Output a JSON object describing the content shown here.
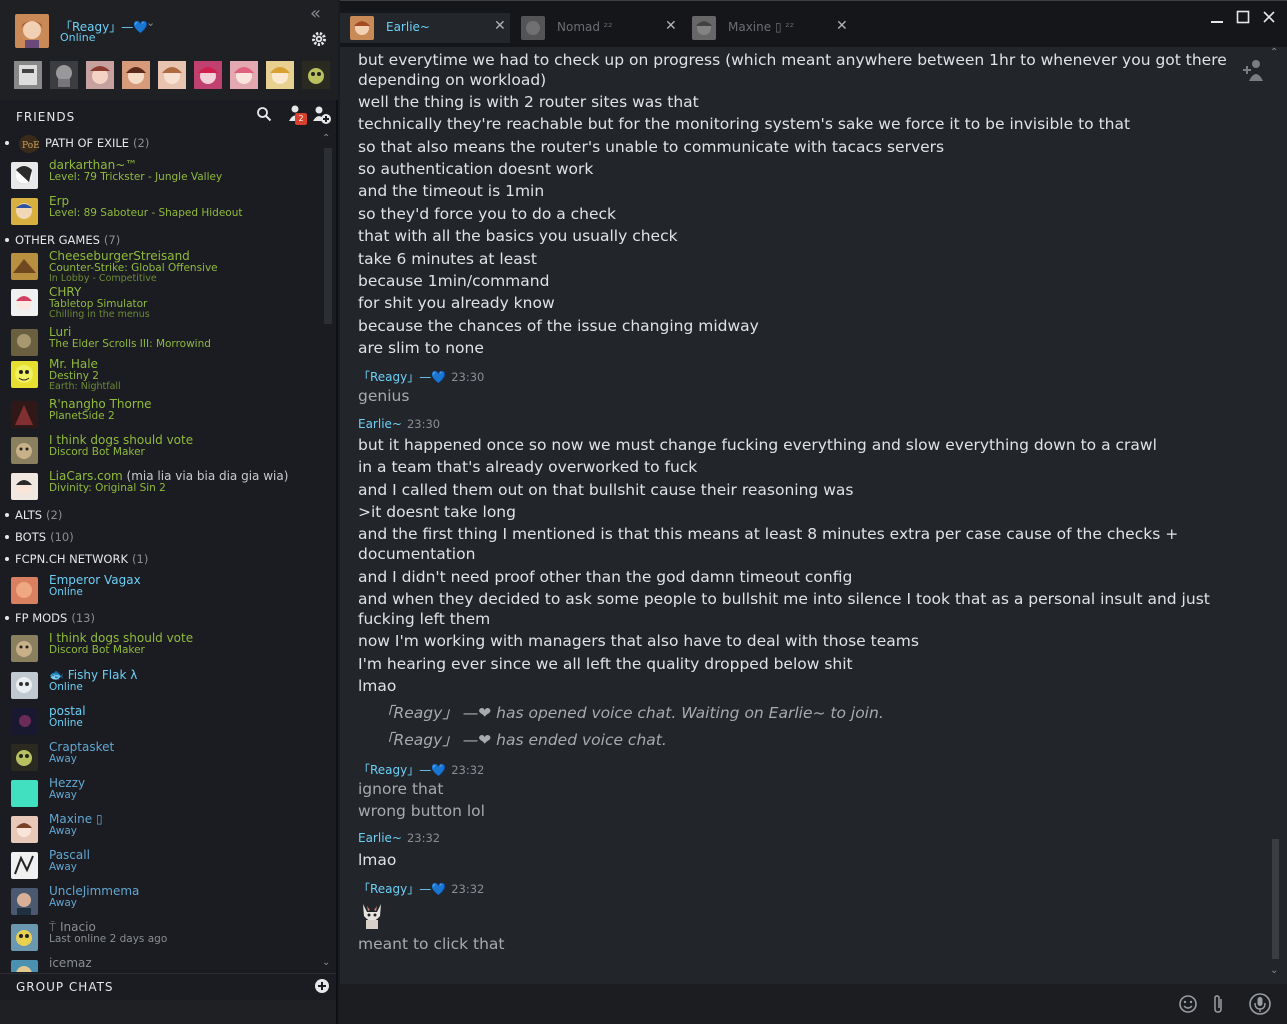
{
  "me": {
    "name": "「Reagy」—💙",
    "status": "Online"
  },
  "friends_header": {
    "title": "FRIENDS",
    "requests_count": "2"
  },
  "groups": {
    "poe": {
      "name": "PATH OF EXILE",
      "count": "(2)"
    },
    "other": {
      "name": "OTHER GAMES",
      "count": "(7)"
    },
    "alts": {
      "name": "ALTS",
      "count": "(2)"
    },
    "bots": {
      "name": "BOTS",
      "count": "(10)"
    },
    "fcpn": {
      "name": "FCPN.CH NETWORK",
      "count": "(1)"
    },
    "fpmods": {
      "name": "FP MODS",
      "count": "(13)"
    }
  },
  "friends": [
    {
      "name": "darkarthan~™",
      "status": "Level: 79 Trickster - Jungle Valley",
      "status2": ""
    },
    {
      "name": "Erp",
      "status": "Level: 89 Saboteur - Shaped Hideout",
      "status2": ""
    },
    {
      "name": "CheeseburgerStreisand",
      "status": "Counter-Strike: Global Offensive",
      "status2": "In Lobby - Competitive"
    },
    {
      "name": "CHRY",
      "status": "Tabletop Simulator",
      "status2": "Chilling in the menus"
    },
    {
      "name": "Luri",
      "status": "The Elder Scrolls III: Morrowind",
      "status2": ""
    },
    {
      "name": "Mr. Hale",
      "status": "Destiny 2",
      "status2": "Earth: Nightfall"
    },
    {
      "name": "R'nangho Thorne",
      "status": "PlanetSide 2",
      "status2": ""
    },
    {
      "name": "I think dogs should vote",
      "status": "Discord Bot Maker",
      "status2": ""
    },
    {
      "name": "LiaCars.com",
      "name_extra": " (mia lia via bia dia gia wia)",
      "status": "Divinity: Original Sin 2",
      "status2": ""
    },
    {
      "name": "Emperor Vagax",
      "status": "Online",
      "status2": ""
    },
    {
      "name": "I think dogs should vote",
      "status": "Discord Bot Maker",
      "status2": ""
    },
    {
      "name": "🐟 Fishy Flak λ",
      "status": "Online",
      "status2": ""
    },
    {
      "name": "postal",
      "status": "Online",
      "status2": ""
    },
    {
      "name": "Craptasket",
      "status": "Away",
      "status2": ""
    },
    {
      "name": "Hezzy",
      "status": "Away",
      "status2": ""
    },
    {
      "name": "Maxine ▯",
      "status": "Away",
      "status2": ""
    },
    {
      "name": "Pascall",
      "status": "Away",
      "status2": ""
    },
    {
      "name": "UncleJimmema",
      "status": "Away",
      "status2": ""
    },
    {
      "name": "⍑ Inacio",
      "status": "Last online 2 days ago",
      "status2": ""
    },
    {
      "name": "icemaz",
      "status": "",
      "status2": ""
    }
  ],
  "group_chats": {
    "title": "GROUP CHATS"
  },
  "tabs": [
    {
      "name": "Earlie~"
    },
    {
      "name": "Nomad ᶻᶻ"
    },
    {
      "name": "Maxine ▯ ᶻᶻ"
    }
  ],
  "messages": {
    "block1": [
      "but everytime we had to check up on progress (which meant anywhere between 1hr to whenever you got there depending on workload)",
      "well the thing is with 2 router sites was that",
      "technically they're reachable but for the monitoring system's sake we force it to be invisible to that",
      "so that also means the router's unable to communicate with tacacs servers",
      "so authentication doesnt work",
      "and the timeout is 1min",
      "so they'd force you to do a check",
      "that with all the basics you usually check",
      "take 6 minutes at least",
      "because 1min/command",
      "for shit you already know",
      "because the chances of the issue changing midway",
      "are slim to none"
    ],
    "author1": {
      "name": "「Reagy」—💙",
      "time": "23:30"
    },
    "block2": [
      "genius"
    ],
    "author2": {
      "name": "Earlie~",
      "time": "23:30"
    },
    "block3": [
      "but it happened once so now we must change fucking everything and slow everything down to a crawl",
      "in a team that's already overworked to fuck",
      "and I called them out on that bullshit cause their reasoning was",
      ">it doesnt take long",
      "and the first thing I mentioned is that this means at least 8 minutes extra per case cause of the checks + documentation",
      "and I didn't need proof other than the god damn timeout config",
      "and when they decided to ask some people to bullshit me into silence I took that as a personal insult and just fucking left them",
      "now I'm working with managers that also have to deal with those teams",
      "I'm hearing ever since we all left the quality dropped below shit",
      "lmao"
    ],
    "sys1": "「Reagy」 —❤ has opened voice chat. Waiting on Earlie~ to join.",
    "sys2": "「Reagy」 —❤ has ended voice chat.",
    "author3": {
      "name": "「Reagy」—💙",
      "time": "23:32"
    },
    "block4": [
      "ignore that",
      "wrong button lol"
    ],
    "author4": {
      "name": "Earlie~",
      "time": "23:32"
    },
    "block5": [
      "lmao"
    ],
    "author5": {
      "name": "「Reagy」—💙",
      "time": "23:32"
    },
    "block6": [
      "meant to click that"
    ]
  },
  "composer": {
    "placeholder": ""
  },
  "colors": {
    "in_game": "#90ba3c",
    "online": "#6dcff6",
    "away": "#62a7d2",
    "accent_badge": "#d9412c"
  }
}
